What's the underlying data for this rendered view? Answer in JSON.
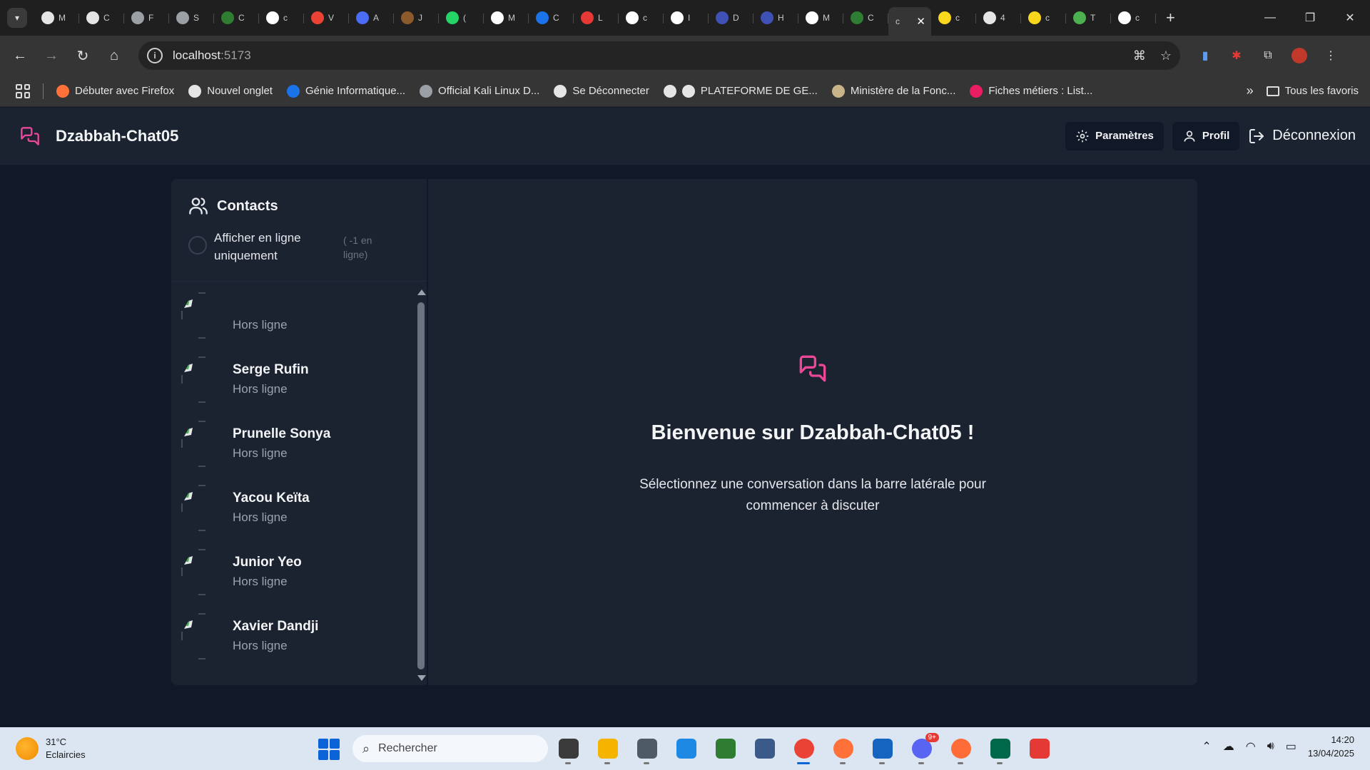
{
  "browser": {
    "active_tab_letter": "c",
    "tabs": [
      {
        "letter": "M",
        "color": "#e5e5e5"
      },
      {
        "letter": "C",
        "color": "#e5e5e5"
      },
      {
        "letter": "F",
        "color": "#9aa0a6"
      },
      {
        "letter": "S",
        "color": "#9aa0a6"
      },
      {
        "letter": "C",
        "color": "#2e7d32"
      },
      {
        "letter": "c",
        "color": "#ffffff"
      },
      {
        "letter": "V",
        "color": "#ea4335"
      },
      {
        "letter": "A",
        "color": "#4a6cf7"
      },
      {
        "letter": "J",
        "color": "#8d5a2b"
      },
      {
        "letter": "(",
        "color": "#25d366"
      },
      {
        "letter": "M",
        "color": "#ffffff"
      },
      {
        "letter": "C",
        "color": "#1a73e8"
      },
      {
        "letter": "L",
        "color": "#e53935"
      },
      {
        "letter": "c",
        "color": "#ffffff"
      },
      {
        "letter": "I",
        "color": "#ffffff"
      },
      {
        "letter": "D",
        "color": "#3f51b5"
      },
      {
        "letter": "H",
        "color": "#3f51b5"
      },
      {
        "letter": "M",
        "color": "#ffffff"
      },
      {
        "letter": "C",
        "color": "#2e7d32"
      }
    ],
    "tabs_after": [
      {
        "letter": "c",
        "color": "#f9d71c"
      },
      {
        "letter": "4",
        "color": "#e5e5e5"
      },
      {
        "letter": "c",
        "color": "#f9d71c"
      },
      {
        "letter": "T",
        "color": "#4caf50"
      },
      {
        "letter": "c",
        "color": "#ffffff"
      }
    ],
    "url_host": "localhost",
    "url_port": ":5173",
    "bookmarks": [
      {
        "label": "Débuter avec Firefox",
        "color": "#ff7139"
      },
      {
        "label": "Nouvel onglet",
        "color": "#e5e5e5"
      },
      {
        "label": "Génie Informatique...",
        "color": "#1a73e8"
      },
      {
        "label": "Official Kali Linux D...",
        "color": "#9aa0a6"
      },
      {
        "label": "Se Déconnecter",
        "color": "#e5e5e5"
      },
      {
        "label": "",
        "color": "#e5e5e5"
      },
      {
        "label": "PLATEFORME DE GE...",
        "color": "#e5e5e5"
      },
      {
        "label": "Ministère de la Fonc...",
        "color": "#c9b48a"
      },
      {
        "label": "Fiches métiers : List...",
        "color": "#e91e63"
      }
    ],
    "all_bookmarks_label": "Tous les favoris"
  },
  "app": {
    "brand": "Dzabbah-Chat05",
    "accent": "#ec4899",
    "header": {
      "settings_label": "Paramètres",
      "profile_label": "Profil",
      "logout_label": "Déconnexion"
    },
    "sidebar": {
      "title": "Contacts",
      "filter_label": "Afficher en ligne uniquement",
      "online_count": "( -1 en ligne)",
      "contacts": [
        {
          "name": "",
          "status": "Hors ligne"
        },
        {
          "name": "Serge Rufin",
          "status": "Hors ligne"
        },
        {
          "name": "Prunelle Sonya",
          "status": "Hors ligne"
        },
        {
          "name": "Yacou Keïta",
          "status": "Hors ligne"
        },
        {
          "name": "Junior Yeo",
          "status": "Hors ligne"
        },
        {
          "name": "Xavier Dandji",
          "status": "Hors ligne"
        }
      ]
    },
    "welcome": {
      "title": "Bienvenue sur Dzabbah-Chat05 !",
      "subtitle": "Sélectionnez une conversation dans la barre latérale pour commencer à discuter"
    }
  },
  "taskbar": {
    "temperature": "31°C",
    "weather": "Eclaircies",
    "search_placeholder": "Rechercher",
    "apps": [
      {
        "name": "task-view",
        "color": "#3b3b3b"
      },
      {
        "name": "file-explorer",
        "color": "#f4b400"
      },
      {
        "name": "kali-app",
        "color": "#4e5b66"
      },
      {
        "name": "vscode",
        "color": "#1e88e5"
      },
      {
        "name": "vectr-app",
        "color": "#2e7d32"
      },
      {
        "name": "mysql-workbench",
        "color": "#3b5a8a"
      },
      {
        "name": "chrome",
        "color": "#ea4335"
      },
      {
        "name": "firefox",
        "color": "#ff7139"
      },
      {
        "name": "notepad",
        "color": "#1565c0"
      },
      {
        "name": "discord",
        "color": "#5865f2"
      },
      {
        "name": "postman",
        "color": "#ff6c37"
      },
      {
        "name": "mongodb-compass",
        "color": "#00684a"
      },
      {
        "name": "reader-app",
        "color": "#e53935"
      }
    ],
    "discord_badge": "9+",
    "time": "14:20",
    "date": "13/04/2025"
  }
}
